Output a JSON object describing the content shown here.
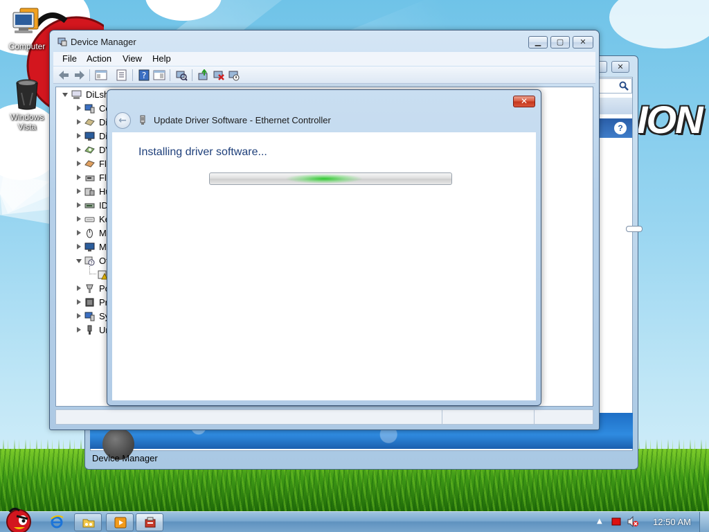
{
  "desktop": {
    "icons": [
      {
        "label": "Computer"
      },
      {
        "label": "Windows Vista"
      }
    ],
    "wallpaper_text": "ION"
  },
  "background_window": {
    "status_text": "Device Manager"
  },
  "device_manager": {
    "title": "Device Manager",
    "menu": [
      "File",
      "Action",
      "View",
      "Help"
    ],
    "tree": {
      "root": "DiLsh",
      "items": [
        "Co",
        "Di",
        "Di",
        "DV",
        "Fl",
        "Fl",
        "Hu",
        "ID",
        "Ke",
        "M",
        "M",
        "Ot",
        "",
        "Po",
        "Pr",
        "Sy",
        "Ur"
      ]
    }
  },
  "dialog": {
    "title": "Update Driver Software - Ethernet Controller",
    "heading": "Installing driver software...",
    "close_label": "✕",
    "back_label": "←",
    "progress_state": "indeterminate"
  },
  "taskbar": {
    "clock": "12:50 AM",
    "colors": {
      "accent": "#5f92bf"
    }
  },
  "colors": {
    "dialog_heading": "#1e3f7a",
    "progress_glow": "#28c828",
    "close_button": "#c4351a"
  }
}
